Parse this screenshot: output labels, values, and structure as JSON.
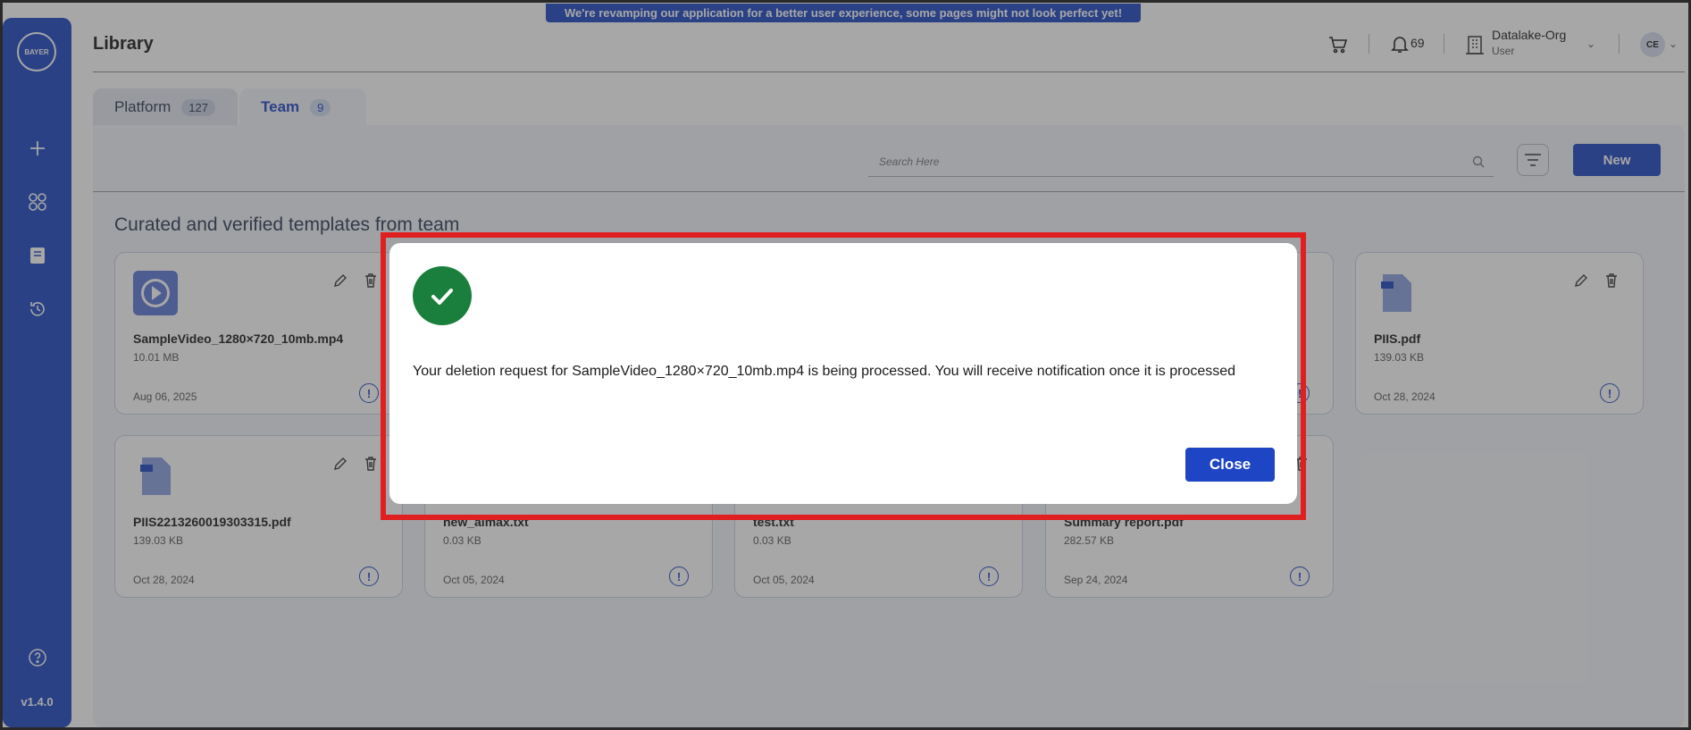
{
  "banner": {
    "text": "We're revamping our application for a better user experience, some pages might not look perfect yet!"
  },
  "sidebar": {
    "logo_text": "BAYER",
    "version": "v1.4.0"
  },
  "header": {
    "title": "Library",
    "notification_count": "69",
    "org_name": "Datalake-Org",
    "org_role": "User",
    "avatar_initials": "CE"
  },
  "tabs": [
    {
      "label": "Platform",
      "count": "127"
    },
    {
      "label": "Team",
      "count": "9"
    }
  ],
  "toolbar": {
    "search_placeholder": "Search Here",
    "new_label": "New"
  },
  "section_title": "Curated and verified templates from team",
  "cards": [
    {
      "name": "SampleVideo_1280×720_10mb.mp4",
      "size": "10.01 MB",
      "date": "Aug 06, 2025",
      "type": "video"
    },
    {
      "name": "PIIS.pdf",
      "size": "139.03 KB",
      "date": "Oct 28, 2024",
      "type": "pdf"
    },
    {
      "name": "PIIS2213260019303315.pdf",
      "size": "139.03 KB",
      "date": "Oct 28, 2024",
      "type": "pdf"
    },
    {
      "name": "new_aimax.txt",
      "size": "0.03 KB",
      "date": "Oct 05, 2024",
      "type": "txt"
    },
    {
      "name": "test.txt",
      "size": "0.03 KB",
      "date": "Oct 05, 2024",
      "type": "txt"
    },
    {
      "name": "Summary report.pdf",
      "size": "282.57 KB",
      "date": "Sep 24, 2024",
      "type": "pdf"
    }
  ],
  "modal": {
    "message": "Your deletion request for SampleVideo_1280×720_10mb.mp4 is being processed. You will receive notification once it is processed",
    "close_label": "Close"
  },
  "colors": {
    "brand": "#1d45c4",
    "success": "#1a7f3c",
    "highlight": "#e02020"
  }
}
